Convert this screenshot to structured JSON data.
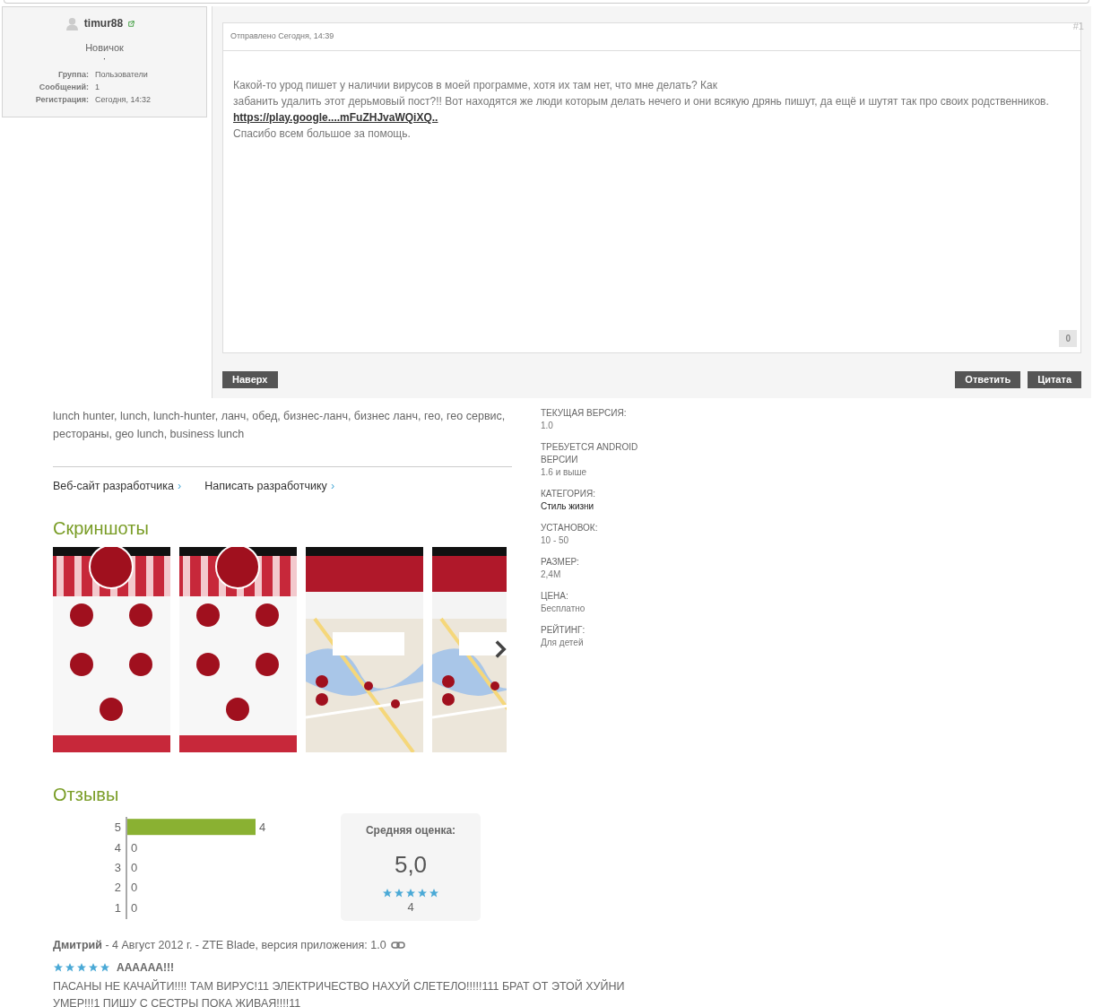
{
  "profile": {
    "username": "timur88",
    "rank": "Новичок",
    "rank_mark": "·",
    "fields": [
      {
        "label": "Группа:",
        "value": "Пользователи"
      },
      {
        "label": "Сообщений:",
        "value": "1"
      },
      {
        "label": "Регистрация:",
        "value": "Сегодня, 14:32"
      }
    ]
  },
  "post": {
    "number": "#1",
    "sent": "Отправлено Сегодня, 14:39",
    "lines": [
      {
        "kind": "text",
        "text": "Какой-то урод пишет у наличии вирусов в моей программе, хотя их там нет, что мне делать? Как"
      },
      {
        "kind": "text",
        "text": "забанить удалить этот дерьмовый пост?!! Вот находятся же люди которым делать нечего и они всякую дрянь пишут, да ещё и шутят так про своих родственников."
      },
      {
        "kind": "link",
        "text": "https://play.google....mFuZHJvaWQiXQ.."
      },
      {
        "kind": "text",
        "text": "Спасибо всем большое за помощь."
      }
    ],
    "reputation": "0",
    "buttons": [
      "Наверх",
      "Ответить",
      "Цитата"
    ]
  },
  "app_page": {
    "tags": "lunch hunter, lunch, lunch-hunter, ланч, обед, бизнес-ланч, бизнес ланч, гео, гео сервис, рестораны, geo lunch, business lunch",
    "developer_links": [
      "Веб-сайт разработчика",
      "Написать разработчику"
    ],
    "link_arrow": "›",
    "screenshots_title": "Скриншоты",
    "screenshots": [
      {
        "kind": "menu"
      },
      {
        "kind": "menu"
      },
      {
        "kind": "map"
      },
      {
        "kind": "map"
      }
    ],
    "reviews_title": "Отзывы",
    "histogram": {
      "chart_data": {
        "type": "bar",
        "orientation": "horizontal",
        "categories": [
          "5",
          "4",
          "3",
          "2",
          "1"
        ],
        "values": [
          4,
          0,
          0,
          0,
          0
        ],
        "data_labels": true
      }
    },
    "average": {
      "label": "Средняя оценка:",
      "value": "5,0",
      "stars": 5,
      "count": "4"
    },
    "review": {
      "author": "Дмитрий",
      "meta": " - 4 Август 2012 г. - ZTE Blade, версия приложения: 1.0",
      "stars": 5,
      "title": "АААААА!!!",
      "body": "ПАСАНЫ НЕ КАЧАЙТИ!!!! ТАМ ВИРУС!11 ЭЛЕКТРИЧЕСТВО НАХУЙ СЛЕТЕЛО!!!!!111 БРАТ ОТ ЭТОЙ ХУЙНИ УМЕР!!!1 ПИШУ С СЕСТРЫ ПОКА ЖИВАЯ!!!!11"
    },
    "details": [
      {
        "label": "ТЕКУЩАЯ ВЕРСИЯ:",
        "value": "1.0"
      },
      {
        "label": "ТРЕБУЕТСЯ ANDROID ВЕРСИИ",
        "value": "1.6 и выше"
      },
      {
        "label": "КАТЕГОРИЯ:",
        "value": "Стиль жизни"
      },
      {
        "label": "УСТАНОВОК:",
        "value": "10 - 50"
      },
      {
        "label": "РАЗМЕР:",
        "value": "2,4M"
      },
      {
        "label": "ЦЕНА:",
        "value": "Бесплатно"
      },
      {
        "label": "РЕЙТИНГ:",
        "value": "Для детей"
      }
    ]
  }
}
